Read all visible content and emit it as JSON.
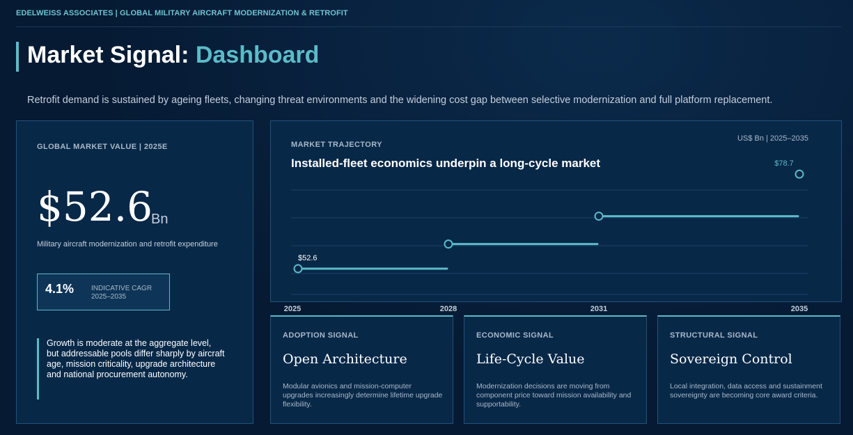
{
  "header": {
    "brand": "EDELWEISS ASSOCIATES | GLOBAL MILITARY AIRCRAFT MODERNIZATION & RETROFIT"
  },
  "page": {
    "title_prefix": "Market Signal: ",
    "title_accent": "Dashboard",
    "subtitle": "Retrofit demand is sustained by ageing fleets, changing threat environments and the widening cost gap between selective modernization and full platform replacement."
  },
  "market_value": {
    "label": "GLOBAL MARKET VALUE | 2025E",
    "value": "$52.6",
    "unit": "Bn",
    "description": "Military aircraft modernization and retrofit expenditure",
    "cagr_value": "4.1%",
    "cagr_label_1": "INDICATIVE CAGR",
    "cagr_label_2": "2025–2035",
    "note": "Growth is moderate at the aggregate level, but addressable pools differ sharply by aircraft age, mission criticality, upgrade architecture and national procurement autonomy."
  },
  "signals": [
    {
      "label": "ADOPTION SIGNAL",
      "title": "Open Architecture",
      "desc": "Modular avionics and mission-computer upgrades increasingly determine lifetime upgrade flexibility."
    },
    {
      "label": "ECONOMIC SIGNAL",
      "title": "Life-Cycle Value",
      "desc": "Modernization decisions are moving from component price toward mission availability and supportability."
    },
    {
      "label": "STRUCTURAL SIGNAL",
      "title": "Sovereign Control",
      "desc": "Local integration, data access and sustainment sovereignty are becoming core award criteria."
    }
  ],
  "chart_data": {
    "type": "line",
    "label": "MARKET TRAJECTORY",
    "title": "Installed-fleet economics underpin a long-cycle market",
    "units_label": "US$ Bn | 2025–2035",
    "x": [
      2025,
      2028,
      2031,
      2035
    ],
    "values": [
      52.6,
      59.4,
      67.1,
      78.7
    ],
    "data_labels": [
      "$52.6",
      "",
      "",
      "$78.7"
    ],
    "xlim": [
      2025,
      2035
    ],
    "ylim": [
      48,
      82
    ],
    "grid": true,
    "colors": {
      "line": "#5bbcc8",
      "grid": "#1f4166",
      "label": "#5bbcc8"
    }
  }
}
